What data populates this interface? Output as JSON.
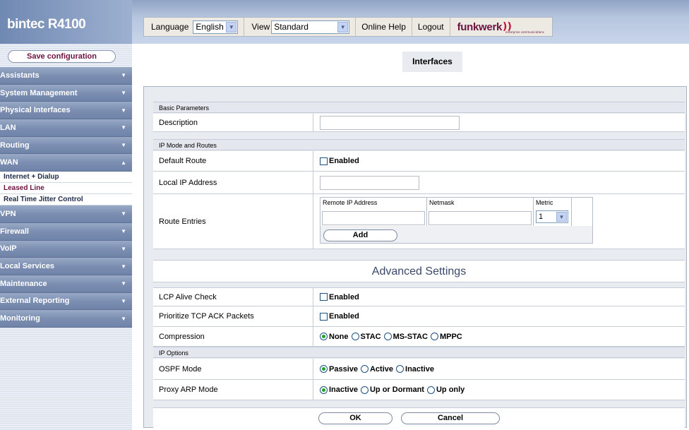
{
  "header": {
    "brand": "bintec R4100",
    "language_label": "Language",
    "language_value": "English",
    "view_label": "View",
    "view_value": "Standard",
    "online_help": "Online Help",
    "logout": "Logout",
    "logo_word": "funkwerk",
    "logo_tagline": "enterprise communications"
  },
  "sidebar": {
    "save_button": "Save configuration",
    "menu": [
      {
        "label": "Assistants",
        "expanded": false
      },
      {
        "label": "System Management",
        "expanded": false
      },
      {
        "label": "Physical Interfaces",
        "expanded": false
      },
      {
        "label": "LAN",
        "expanded": false
      },
      {
        "label": "Routing",
        "expanded": false
      },
      {
        "label": "WAN",
        "expanded": true
      },
      {
        "label": "VPN",
        "expanded": false
      },
      {
        "label": "Firewall",
        "expanded": false
      },
      {
        "label": "VoIP",
        "expanded": false
      },
      {
        "label": "Local Services",
        "expanded": false
      },
      {
        "label": "Maintenance",
        "expanded": false
      },
      {
        "label": "External Reporting",
        "expanded": false
      },
      {
        "label": "Monitoring",
        "expanded": false
      }
    ],
    "wan_subitems": [
      {
        "label": "Internet + Dialup",
        "active": false
      },
      {
        "label": "Leased Line",
        "active": true
      },
      {
        "label": "Real Time Jitter Control",
        "active": false
      }
    ]
  },
  "main": {
    "page_title": "Interfaces",
    "basic_section": "Basic Parameters",
    "description_label": "Description",
    "description_value": "",
    "ip_mode_section": "IP Mode and Routes",
    "default_route_label": "Default Route",
    "default_route_option": "Enabled",
    "local_ip_label": "Local IP Address",
    "local_ip_value": "",
    "route_entries_label": "Route Entries",
    "route_table": {
      "columns": [
        "Remote IP Address",
        "Netmask",
        "Metric"
      ],
      "metric_value": "1",
      "add_button": "Add"
    },
    "advanced_heading": "Advanced Settings",
    "lcp_label": "LCP Alive Check",
    "lcp_option": "Enabled",
    "tcp_ack_label": "Prioritize TCP ACK Packets",
    "tcp_ack_option": "Enabled",
    "compression_label": "Compression",
    "compression_options": [
      "None",
      "STAC",
      "MS-STAC",
      "MPPC"
    ],
    "compression_selected": "None",
    "ip_options_section": "IP Options",
    "ospf_label": "OSPF Mode",
    "ospf_options": [
      "Passive",
      "Active",
      "Inactive"
    ],
    "ospf_selected": "Passive",
    "proxy_arp_label": "Proxy ARP Mode",
    "proxy_arp_options": [
      "Inactive",
      "Up or Dormant",
      "Up only"
    ],
    "proxy_arp_selected": "Inactive",
    "ok_button": "OK",
    "cancel_button": "Cancel"
  },
  "colors": {
    "brand_accent": "#6d1240",
    "menu_bg": "#7c8fb2",
    "radio_selected": "#21a121"
  }
}
